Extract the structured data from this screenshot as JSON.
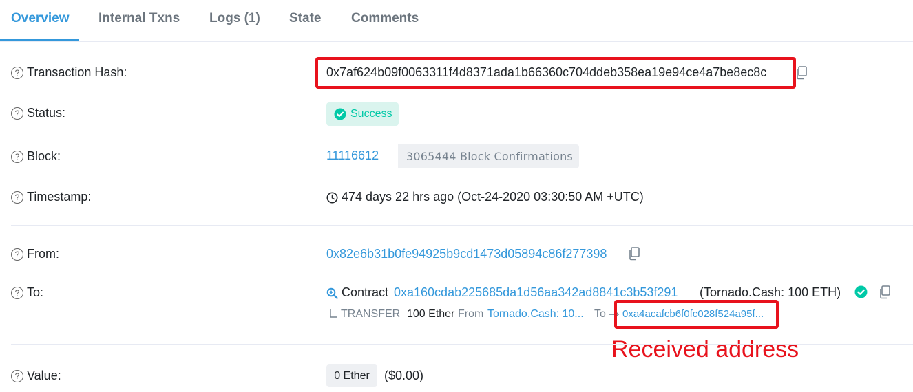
{
  "tabs": [
    {
      "label": "Overview",
      "active": true
    },
    {
      "label": "Internal Txns"
    },
    {
      "label": "Logs (1)"
    },
    {
      "label": "State"
    },
    {
      "label": "Comments"
    }
  ],
  "rows": {
    "tx_hash": {
      "label": "Transaction Hash:",
      "value": "0x7af624b09f0063311f4d8371ada1b66360c704ddeb358ea19e94ce4a7be8ec8c"
    },
    "status": {
      "label": "Status:",
      "value": "Success"
    },
    "block": {
      "label": "Block:",
      "number": "11116612",
      "confirmations": "3065444 Block Confirmations"
    },
    "timestamp": {
      "label": "Timestamp:",
      "value": "474 days 22 hrs ago (Oct-24-2020 03:30:50 AM +UTC)"
    },
    "from": {
      "label": "From:",
      "address": "0x82e6b31b0fe94925b9cd1473d05894c86f277398"
    },
    "to": {
      "label": "To:",
      "contract_label": "Contract",
      "contract_address": "0xa160cdab225685da1d56aa342ad8841c3b53f291",
      "contract_name": "(Tornado.Cash: 100 ETH)",
      "transfer": {
        "prefix": "TRANSFER",
        "amount": "100 Ether",
        "from_label": "From",
        "from_value": "Tornado.Cash: 10...",
        "to_label": "To",
        "to_value": "0xa4acafcb6f0fc028f524a95f..."
      }
    },
    "value": {
      "label": "Value:",
      "amount": "0 Ether",
      "usd": "($0.00)"
    }
  },
  "annotation": "Received address",
  "colors": {
    "link": "#3498db",
    "success": "#00c9a7",
    "annotation": "#e8121c"
  }
}
